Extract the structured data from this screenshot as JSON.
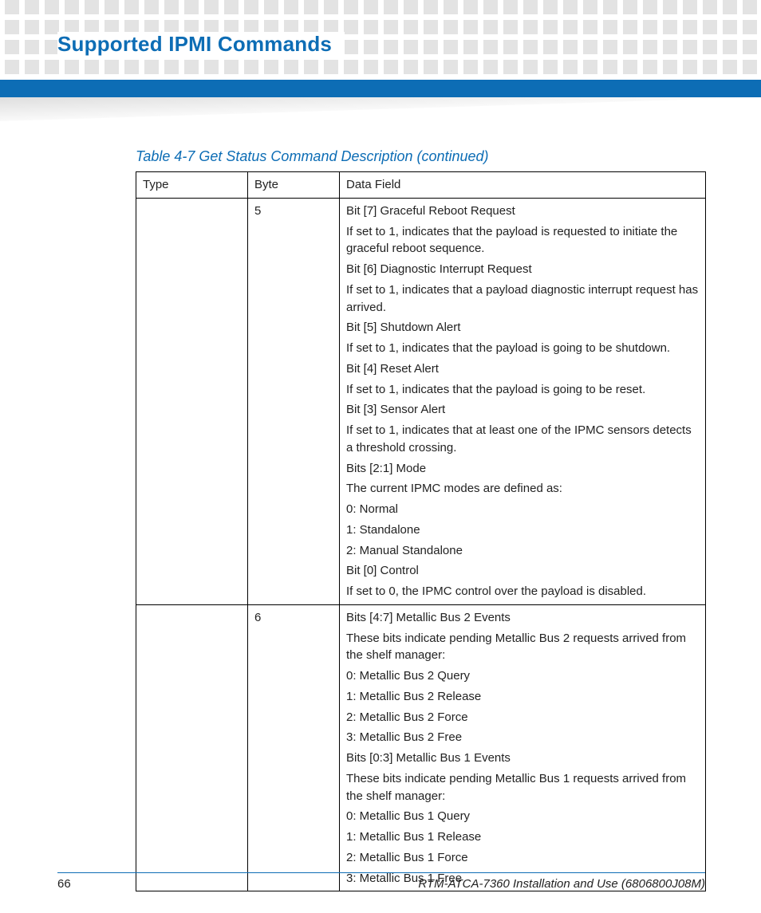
{
  "header": {
    "title": "Supported IPMI Commands"
  },
  "table": {
    "caption": "Table 4-7 Get Status Command Description (continued)",
    "columns": {
      "c0": "Type",
      "c1": "Byte",
      "c2": "Data Field"
    },
    "rows": [
      {
        "type": "",
        "byte": "5",
        "lines": [
          "Bit [7] Graceful Reboot Request",
          "If set to 1, indicates that the payload is requested to initiate the graceful reboot sequence.",
          "Bit [6] Diagnostic Interrupt Request",
          "If set to 1, indicates that a payload diagnostic interrupt request has arrived.",
          "Bit [5] Shutdown Alert",
          "If set to 1, indicates that the payload is going to be shutdown.",
          "Bit [4] Reset Alert",
          "If set to 1, indicates that the payload is going to be reset.",
          "Bit [3] Sensor Alert",
          "If set to 1, indicates that at least one of the IPMC sensors detects a threshold crossing.",
          "Bits [2:1] Mode",
          "The current IPMC modes are defined as:",
          "0: Normal",
          "1: Standalone",
          "2: Manual Standalone",
          "Bit [0] Control",
          "If set to 0, the IPMC control over the payload is disabled."
        ]
      },
      {
        "type": "",
        "byte": "6",
        "lines": [
          "Bits [4:7] Metallic Bus 2 Events",
          "These bits indicate pending Metallic Bus 2 requests arrived from the shelf manager:",
          "0: Metallic Bus 2 Query",
          "1: Metallic Bus 2 Release",
          "2: Metallic Bus 2 Force",
          "3: Metallic Bus 2 Free",
          "Bits [0:3] Metallic Bus 1 Events",
          "These bits indicate pending Metallic Bus 1 requests arrived from the shelf manager:",
          "0: Metallic Bus 1 Query",
          "1: Metallic Bus 1 Release",
          "2: Metallic Bus 1 Force",
          "3: Metallic Bus 1 Free"
        ]
      }
    ]
  },
  "footer": {
    "page": "66",
    "docid": "RTM-ATCA-7360 Installation and Use (6806800J08M)"
  }
}
